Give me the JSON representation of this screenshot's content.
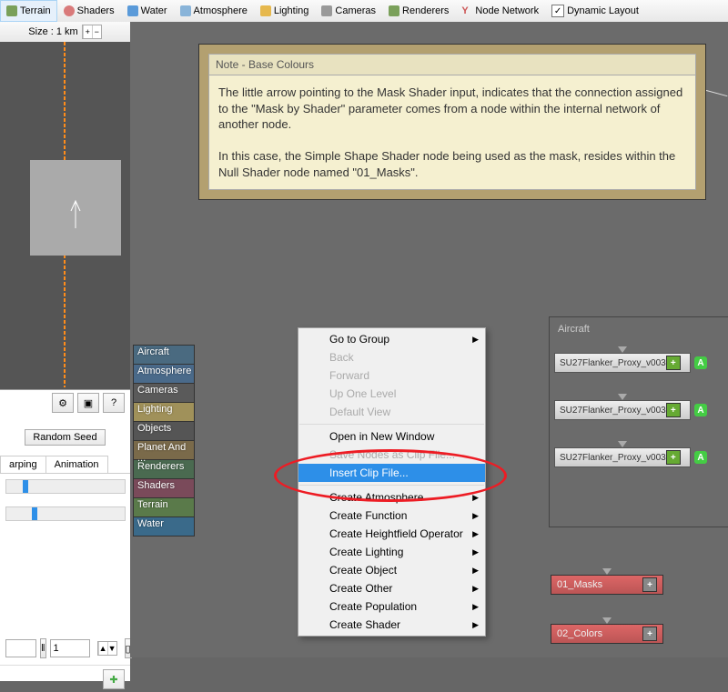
{
  "toolbar": {
    "items": [
      {
        "label": "Terrain",
        "color": "#7aa05a"
      },
      {
        "label": "Shaders",
        "color": "#d97a7a"
      },
      {
        "label": "Water",
        "color": "#5a9ad9"
      },
      {
        "label": "Atmosphere",
        "color": "#89b4d9"
      },
      {
        "label": "Lighting",
        "color": "#e6b84d"
      },
      {
        "label": "Cameras",
        "color": "#999"
      },
      {
        "label": "Renderers",
        "color": "#7aa05a"
      },
      {
        "label": "Node Network",
        "color": "#cc5555"
      },
      {
        "label": "Dynamic Layout",
        "check": true
      }
    ]
  },
  "size_label": "Size : 1 km",
  "random_seed": "Random Seed",
  "tabs": [
    "arping",
    "Animation"
  ],
  "note": {
    "title": "Note - Base Colours",
    "p1": "The little arrow pointing to the Mask Shader input, indicates that the connection assigned to the \"Mask by Shader\" parameter comes from a node within the internal network of another node.",
    "p2": "In this case, the Simple Shape Shader node being used as the mask, resides within the Null Shader node named \"01_Masks\"."
  },
  "categories": [
    {
      "label": "Aircraft",
      "color": "#4a6a80"
    },
    {
      "label": "Atmosphere",
      "color": "#4a6a8a"
    },
    {
      "label": "Cameras",
      "color": "#5a5a5a"
    },
    {
      "label": "Lighting",
      "color": "#a0915a"
    },
    {
      "label": "Objects",
      "color": "#555"
    },
    {
      "label": "Planet And ...",
      "color": "#7a6a4a"
    },
    {
      "label": "Renderers",
      "color": "#4a6a50"
    },
    {
      "label": "Shaders",
      "color": "#7a4a5a"
    },
    {
      "label": "Terrain",
      "color": "#5a7a4a"
    },
    {
      "label": "Water",
      "color": "#3a6a8a"
    }
  ],
  "menu": {
    "go": "Go to Group",
    "back": "Back",
    "fwd": "Forward",
    "up": "Up One Level",
    "def": "Default View",
    "open": "Open in New Window",
    "save": "Save Nodes as Clip File...",
    "insert": "Insert Clip File...",
    "atmos": "Create Atmosphere",
    "func": "Create Function",
    "height": "Create Heightfield Operator",
    "light": "Create Lighting",
    "obj": "Create Object",
    "other": "Create Other",
    "pop": "Create Population",
    "shader": "Create Shader"
  },
  "aircraft": {
    "title": "Aircraft",
    "item": "SU27Flanker_Proxy_v003"
  },
  "red_nodes": [
    "01_Masks",
    "02_Colors"
  ],
  "spin_val": "1"
}
